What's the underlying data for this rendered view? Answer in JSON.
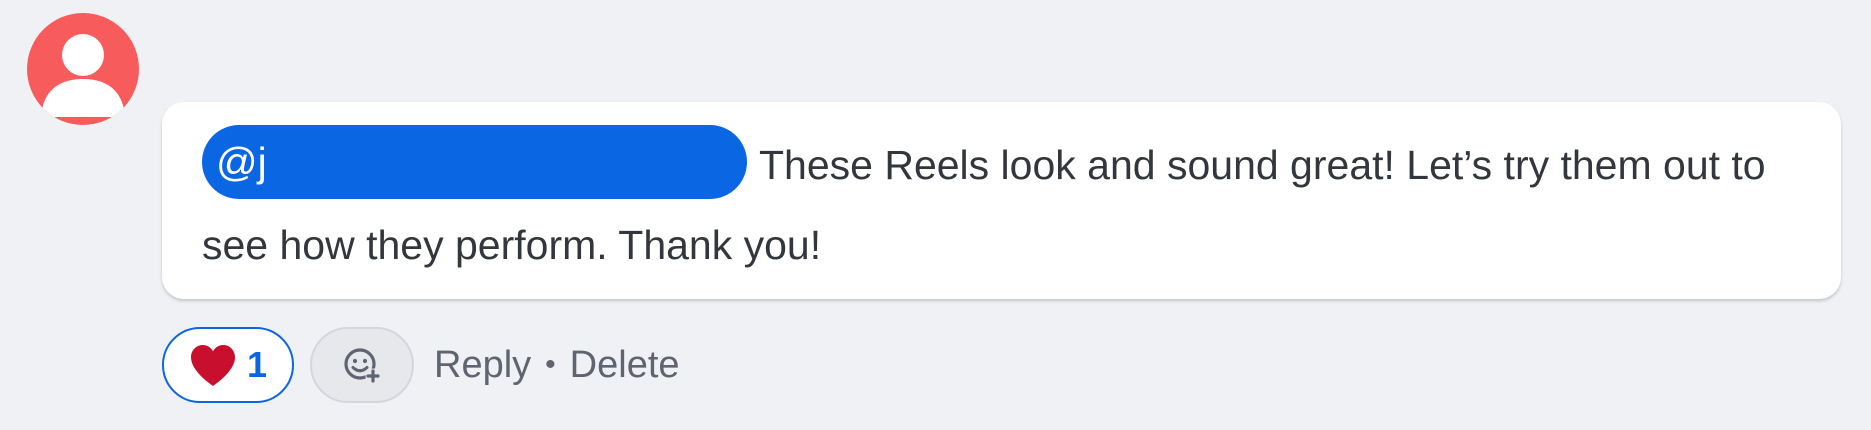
{
  "comment": {
    "avatar_icon": "default-user-icon",
    "mention": "@j",
    "text": "These Reels look and sound great! Let’s try them out to see how they perform. Thank you!"
  },
  "actions": {
    "like_icon": "heart-icon",
    "like_count": "1",
    "react_icon": "add-reaction-icon",
    "reply_label": "Reply",
    "separator": "•",
    "delete_label": "Delete"
  },
  "colors": {
    "background": "#f0f1f4",
    "avatar": "#f85b5b",
    "mention_bg": "#0b66e4",
    "heart": "#c8102e",
    "accent": "#0b66e4"
  }
}
